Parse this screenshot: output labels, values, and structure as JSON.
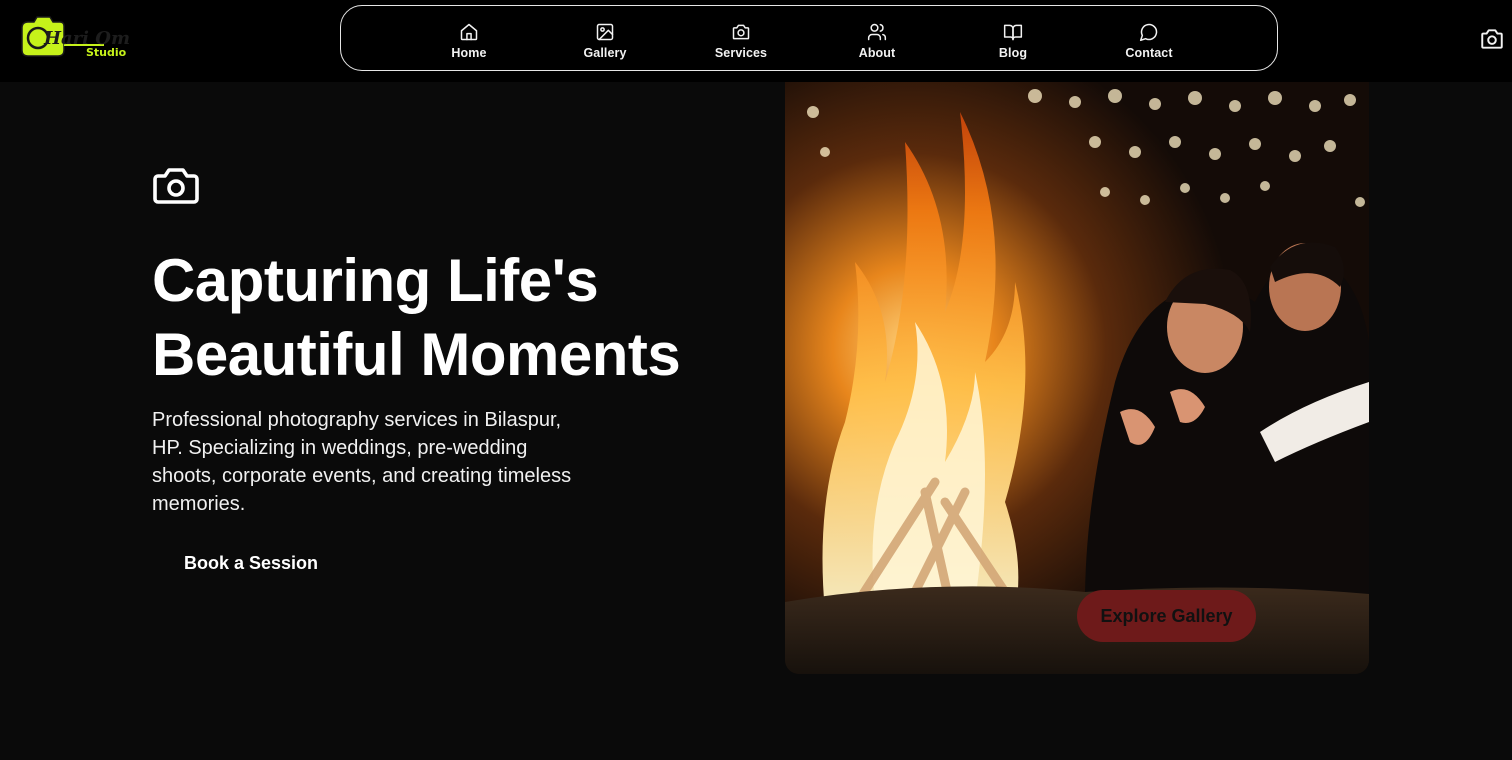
{
  "brand": {
    "logo_line1": "Hari Om",
    "logo_line2": "Studio",
    "logo_color": "#c6f21a"
  },
  "nav": {
    "items": [
      {
        "label": "Home",
        "icon": "home-icon"
      },
      {
        "label": "Gallery",
        "icon": "image-icon"
      },
      {
        "label": "Services",
        "icon": "camera-icon"
      },
      {
        "label": "About",
        "icon": "users-icon"
      },
      {
        "label": "Blog",
        "icon": "book-icon"
      },
      {
        "label": "Contact",
        "icon": "message-icon"
      }
    ],
    "right_icon": "camera-icon"
  },
  "hero": {
    "icon": "camera-icon",
    "title_line1": "Capturing Life's",
    "title_line2": "Beautiful Moments",
    "subtitle": "Professional photography services in Bilaspur, HP. Specializing in weddings, pre-wedding shoots, corporate events, and creating timeless memories.",
    "cta_label": "Book a Session",
    "image_alt": "Couple warming hands by a bonfire at night",
    "image_button_label": "Explore Gallery"
  },
  "colors": {
    "background": "#0a0a0a",
    "header": "#000000",
    "accent_button": "#6e1a1a",
    "logo": "#c6f21a"
  }
}
